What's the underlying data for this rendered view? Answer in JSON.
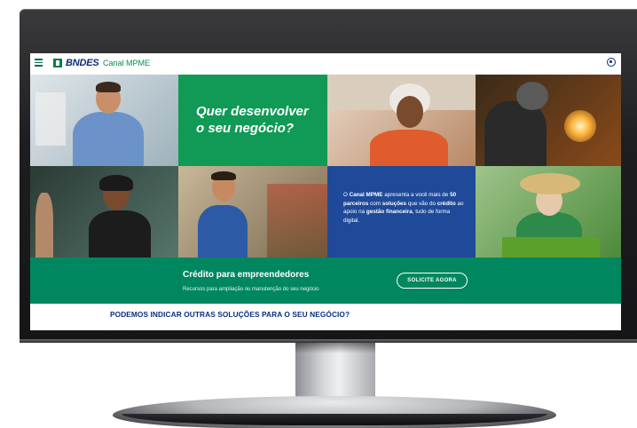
{
  "header": {
    "brand": "BNDES",
    "channel": "Canal MPME"
  },
  "hero": {
    "title": "Quer desenvolver o seu negócio?"
  },
  "info": {
    "parts": [
      "O ",
      "Canal MPME",
      " apresenta a você mais de ",
      "50 parceiros",
      " com ",
      "soluções",
      " que vão do ",
      "crédito",
      " ao apoio na ",
      "gestão financeira",
      ", tudo de forma digital."
    ]
  },
  "credit_band": {
    "title": "Crédito para empreendedores",
    "subtitle": "Recursos para ampliação ou manutenção do seu negócio",
    "cta": "SOLICITE AGORA"
  },
  "section_title": "PODEMOS INDICAR OUTRAS SOLUÇÕES PARA O SEU NEGÓCIO?",
  "icons": {
    "menu": "hamburger-menu-icon",
    "user": "user-account-icon",
    "brand_mark": "bndes-logo-mark"
  },
  "colors": {
    "green": "#109a55",
    "band_green": "#00875f",
    "blue": "#1f4a9a",
    "dark_blue": "#0a2f7e"
  }
}
